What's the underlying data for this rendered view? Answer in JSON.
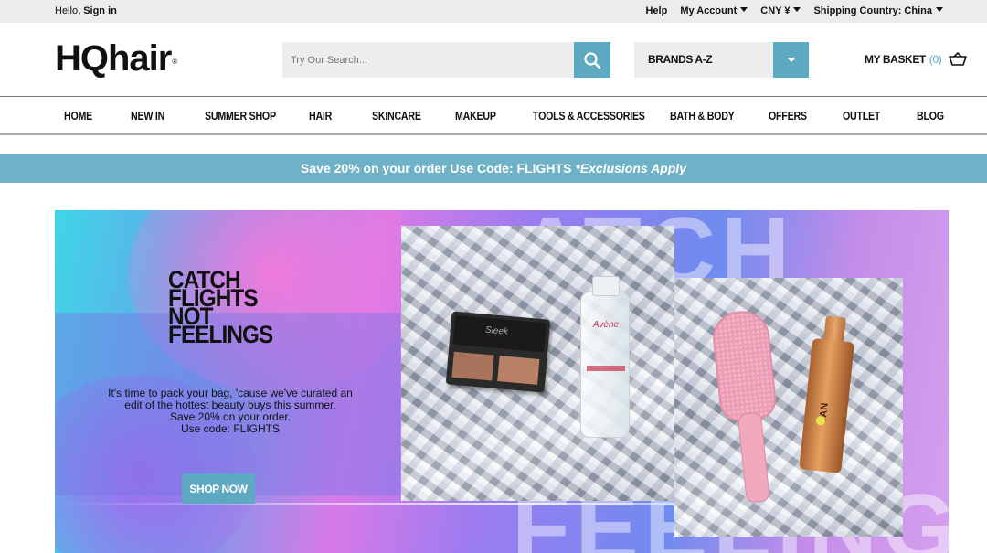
{
  "topbar": {
    "hello": "Hello.",
    "sign_in": "Sign in",
    "help": "Help",
    "my_account": "My Account",
    "currency": "CNY ¥",
    "shipping": "Shipping Country: China"
  },
  "header": {
    "logo": "HQhair",
    "search_placeholder": "Try Our Search...",
    "brands_label": "BRANDS A-Z",
    "basket_label": "MY BASKET",
    "basket_count": "(0)"
  },
  "nav": {
    "items": [
      "HOME",
      "NEW IN",
      "SUMMER SHOP",
      "HAIR",
      "SKINCARE",
      "MAKEUP",
      "TOOLS & ACCESSORIES",
      "BATH & BODY",
      "OFFERS",
      "OUTLET",
      "BLOG"
    ]
  },
  "promo": {
    "text": "Save 20% on your order  Use Code: FLIGHTS",
    "emphasis": "*Exclusions Apply"
  },
  "hero": {
    "headline": "CATCH\nFLIGHTS\nNOT\nFEELINGS",
    "copy_line1": "It's time to pack your bag, 'cause we've curated an",
    "copy_line2": "edit of the hottest beauty buys this summer.",
    "copy_line3": "Save 20% on your order.",
    "copy_line4": "Use code: FLIGHTS",
    "cta": "SHOP NOW",
    "bg_letters_top": "ATCH",
    "bg_letters_bottom": "FEELING",
    "product_compact_label": "Sleek",
    "product_bottle_label": "Avène",
    "product_tanner_label": "TAN"
  },
  "colors": {
    "accent": "#5ea9c2",
    "promo_bg": "#6fb1c6",
    "topbar_bg": "#ececec"
  }
}
